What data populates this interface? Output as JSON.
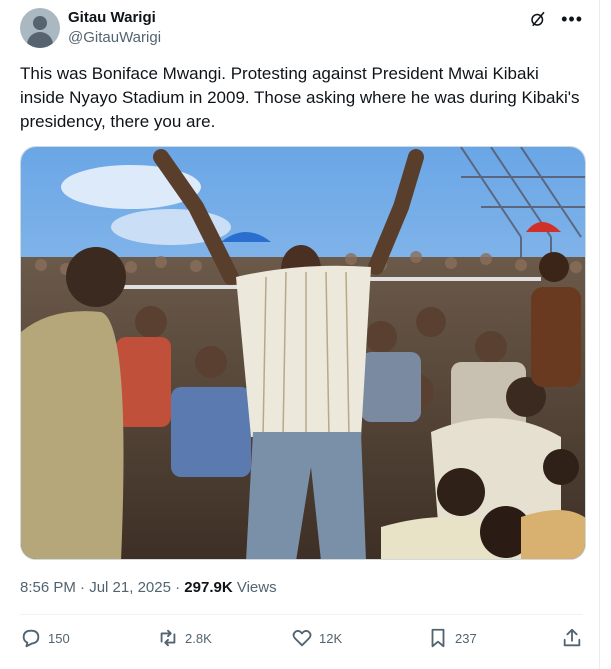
{
  "author": {
    "name": "Gitau Warigi",
    "handle": "@GitauWarigi"
  },
  "header_icons": [
    "grok-icon",
    "more-icon"
  ],
  "tweet": {
    "text": "This was Boniface Mwangi. Protesting against President Mwai Kibaki inside Nyayo Stadium in 2009. Those asking where he was during Kibaki's presidency, there you are."
  },
  "meta": {
    "time": "8:56 PM",
    "sep1": " · ",
    "date": "Jul 21, 2025",
    "sep2": " · ",
    "views_count": "297.9K",
    "views_label": " Views"
  },
  "actions": {
    "replies": "150",
    "reposts": "2.8K",
    "likes": "12K",
    "bookmarks": "237"
  },
  "colors": {
    "text": "#0f1419",
    "muted": "#536471",
    "accent": "#1d9bf0"
  }
}
